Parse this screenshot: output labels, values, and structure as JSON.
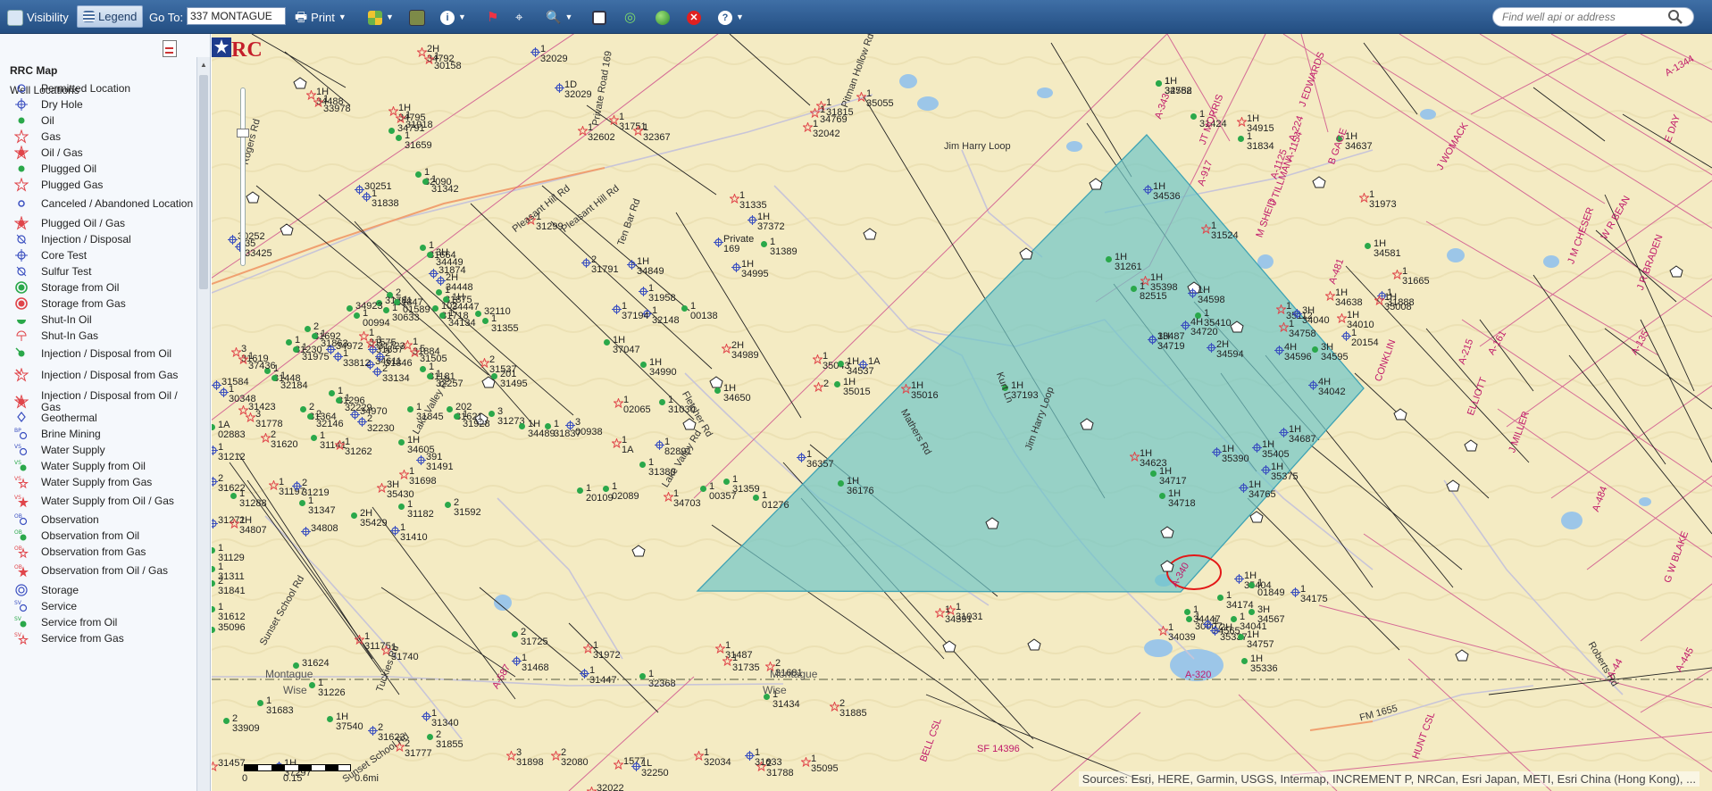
{
  "toolbar": {
    "visibility": "Visibility",
    "legend": "Legend",
    "goto_label": "Go To:",
    "goto_value": "337 MONTAGUE",
    "print": "Print",
    "search_placeholder": "Find well api or address"
  },
  "legend": {
    "title": "RRC Map",
    "section": "Well Locations",
    "items": [
      "Permitted Location",
      "Dry Hole",
      "Oil",
      "Gas",
      "Oil / Gas",
      "Plugged Oil",
      "Plugged Gas",
      "Canceled / Abandoned Location",
      "Plugged Oil / Gas",
      "Injection / Disposal",
      "Core Test",
      "Sulfur Test",
      "Storage from Oil",
      "Storage from Gas",
      "Shut-In Oil",
      "Shut-In Gas",
      "Injection / Disposal from Oil",
      "Injection / Disposal from Gas",
      "Injection / Disposal from Oil / Gas",
      "Geothermal",
      "Brine Mining",
      "Water Supply",
      "Water Supply from Oil",
      "Water Supply from Gas",
      "Water Supply from Oil / Gas",
      "Observation",
      "Observation from Oil",
      "Observation from Gas",
      "Observation from Oil / Gas",
      "Storage",
      "Service",
      "Service from Oil",
      "Service from Gas"
    ]
  },
  "map": {
    "roads": [
      "Pleasant Hill Rd",
      "Pleasant Hill Rd",
      "Ten Bar Rd",
      "Pitman Hollow Rd",
      "Lake Valley Rd",
      "Lake Valley Rd",
      "Fletcher Rd",
      "Mathers Rd",
      "Jim Harry Loop",
      "Jim Harry Loop",
      "Kurt Ln",
      "Sunset School Rd",
      "Sunset School Rd",
      "Tuckies Rd",
      "Roberts Rd",
      "FM 1655",
      "Rogers Rd",
      "Private Road 169"
    ],
    "county_left": "Montague",
    "county_right": "Wise",
    "county_left2": "Montague",
    "county_right2": "Wise",
    "surveys": [
      "J EDWARDS",
      "A-224",
      "B GAGE",
      "J TILLMAN",
      "M SHEID",
      "JT MORRIS",
      "A-917",
      "A-343",
      "J WOMACK",
      "W R BEAN",
      "J R BRADEN",
      "E DAY",
      "J M CHESER",
      "A-1344",
      "J MILLER",
      "G W BLAKE",
      "HUNT CSL",
      "BELL CSL",
      "A-320",
      "A-587",
      "A-340",
      "A-215",
      "A-44",
      "A-484",
      "A-445",
      "A-161",
      "A-1125",
      "A-1154",
      "A-481",
      "ELLIOTT",
      "CONKLIN",
      "SF 14396",
      "A-135"
    ],
    "wells": [
      "2H 34792",
      "1H 34488",
      "1H 34795",
      "34791",
      "1 32090",
      "30251",
      "30252",
      "1 31664",
      "31874",
      "1 31875",
      "2 31847",
      "31781",
      "102 31718",
      "32110",
      "1 31884",
      "34923",
      "2 31692",
      "1 31575",
      "31723",
      "34972",
      "34611",
      "1 31230",
      "3 31619",
      "1 31448",
      "31584",
      "31423",
      "2 31364",
      "1 31296",
      "34970",
      "1 31181",
      "202 31621",
      "1 31845",
      "201 31495",
      "3 31273",
      "2 31537",
      "1H 34489",
      "1 31837",
      "1A 02883",
      "1 31212",
      "2 31620",
      "1 31141",
      "1 31262",
      "1H 34605",
      "391 31491",
      "1 31698",
      "2 31622",
      "1 31288",
      "1 31197",
      "2 31219",
      "3H 35430",
      "2H 35429",
      "1 31347",
      "2 31592",
      "1 31182",
      "31271",
      "2H 34807",
      "34808",
      "1 31410",
      "1 31129",
      "1 31311",
      "2 31841",
      "1 31612",
      "35096",
      "1 31175",
      "1 31740",
      "31624",
      "1 31226",
      "1 31683",
      "2 33909",
      "1H 37540",
      "2 31855",
      "1 31340",
      "2 31623",
      "2 31777",
      "3 31898",
      "2 32080",
      "1577",
      "31457",
      "1H 37297",
      "31646",
      "32022",
      "1L 32250",
      "1 32034",
      "2 31788",
      "1 35095",
      "1 32029",
      "1D 32029",
      "1 32602",
      "1 31751",
      "1 32367",
      "1 31299",
      "2 31791",
      "1H 34849",
      "1 31958",
      "1 32148",
      "1 37194",
      "1H 37047",
      "1 00138",
      "Private 169",
      "1H 34995",
      "2H 34989",
      "1H 34990",
      "1H 34650",
      "1 02065",
      "1 31030",
      "3 00938",
      "1 1A",
      "1 82891",
      "1 31380",
      "1 20109",
      "1 02089",
      "1 00357",
      "1 31359",
      "1 34703",
      "1 01276",
      "2 31725",
      "1 31972",
      "1 31468",
      "1 31447",
      "1 32368",
      "1 31487",
      "1 31735",
      "2 31681",
      "1 31434",
      "2 31885",
      "1 31633",
      "1 35055",
      "1 31815",
      "1 34769",
      "1 32042",
      "1 31335",
      "1H 37372",
      "1 31389",
      "1 35043",
      "1A",
      "2",
      "1H 35015",
      "1H 35016",
      "1H 37193",
      "1 36357",
      "1H 36176",
      "1 31031",
      "1 34391",
      "1H 34623",
      "1H 34537",
      "1H 34536",
      "1H 34582",
      "1 32758",
      "1 31424",
      "1H 34915",
      "1 31834",
      "1H 34637",
      "1 31524",
      "1H 34581",
      "1 31973",
      "1 31665",
      "1 31888",
      "1H 35008",
      "1H 34638",
      "1H 34010",
      "1 35112",
      "1 34758",
      "1 20154",
      "3H 34595",
      "4H 34596",
      "2H 34594",
      "1H 34598",
      "4H 34042",
      "3H 34040",
      "1H 31261",
      "1H 35398",
      "1 35410",
      "1 82515",
      "4H 34720",
      "33487",
      "1H 34719",
      "1H 35405",
      "1H 34717",
      "1H 34718",
      "1H 35390",
      "1H 34765",
      "1H 34687",
      "1H 35375",
      "1H 35404",
      "1 01849",
      "1 34175",
      "1 34174",
      "1 34447",
      "1 30007",
      "1 34565",
      "1 34041",
      "3H 34567",
      "2H 35337",
      "1H 34757",
      "1 34039",
      "1H 35336",
      "1 30158",
      "1 33978",
      "1 31918",
      "1 31659",
      "1 31342",
      "1 31838",
      "35 33425",
      "3H 34449",
      "2H 34448",
      "1H 34447",
      "1 01589",
      "1 30633",
      "1 34134",
      "1 31355",
      "5 31505",
      "1 00994",
      "1 31863",
      "3 31857",
      "2 31846",
      "1 33812",
      "2 33134",
      "1 31975",
      "1 37436",
      "1 32184",
      "1 30348",
      "3 31778",
      "2 32146",
      "1 32229",
      "2 32230",
      "1 32257",
      "1 31928"
    ]
  },
  "scalebar": {
    "left": "0",
    "mid": "0.15",
    "right": "0.6mi"
  },
  "attribution": "Sources: Esri, HERE, Garmin, USGS, Intermap, INCREMENT P, NRCan, Esri Japan, METI, Esri China (Hong Kong), ...",
  "colors": {
    "toolbar": "#2d5a90",
    "map_bg": "#f4ebc3",
    "selection_fill": "#6fc6c8",
    "oil": "#2aa84a",
    "gas": "#e0454a",
    "permit": "#3a4fc0",
    "survey_line": "#d56a95"
  }
}
